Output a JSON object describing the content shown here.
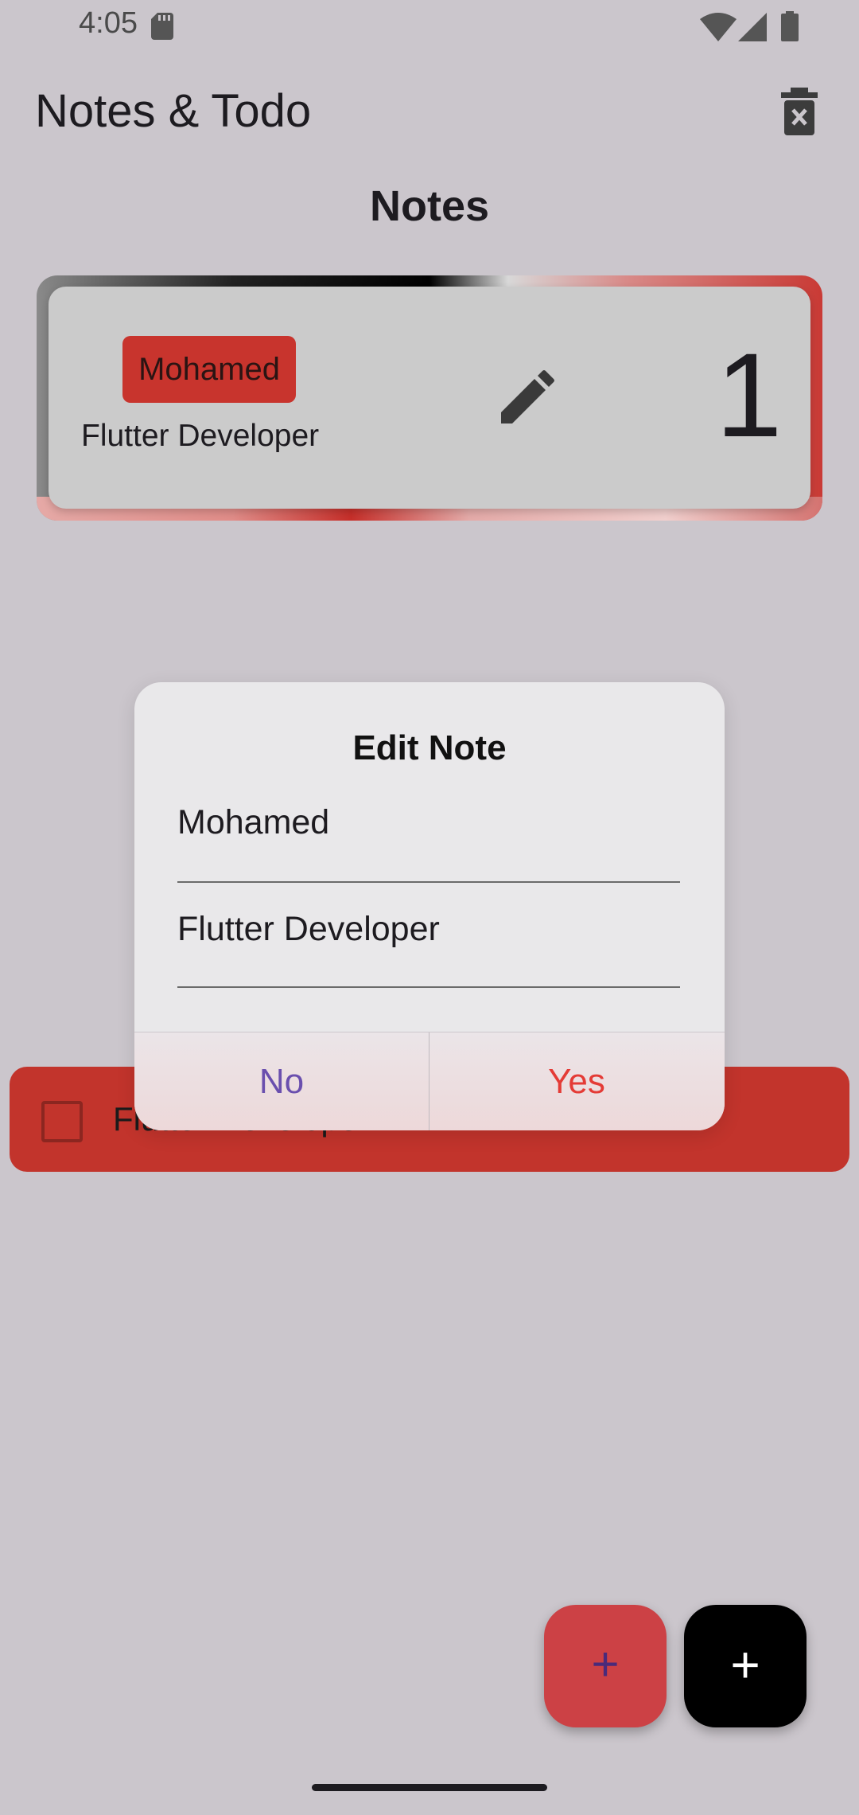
{
  "status_bar": {
    "time": "4:05",
    "icons": [
      "sd-card-icon",
      "wifi-icon",
      "signal-icon",
      "battery-icon"
    ]
  },
  "app_bar": {
    "title": "Notes & Todo",
    "action_icon": "delete-forever-icon"
  },
  "notes_section": {
    "heading": "Notes",
    "notes": [
      {
        "title": "Mohamed",
        "subtitle": "Flutter Developer",
        "number": "1",
        "edit_icon": "edit-icon"
      }
    ]
  },
  "todo_item": {
    "text": "Flutter Developer",
    "checked": false
  },
  "dialog": {
    "title": "Edit  Note",
    "title_field_value": "Mohamed",
    "body_field_value": "Flutter Developer",
    "no_label": "No",
    "yes_label": "Yes"
  },
  "fabs": {
    "note_label": "+",
    "todo_label": "+"
  },
  "colors": {
    "background": "#cbc6cc",
    "accent_red": "#c8342d",
    "yes_color": "#e43b36",
    "no_color": "#6a4fae"
  }
}
